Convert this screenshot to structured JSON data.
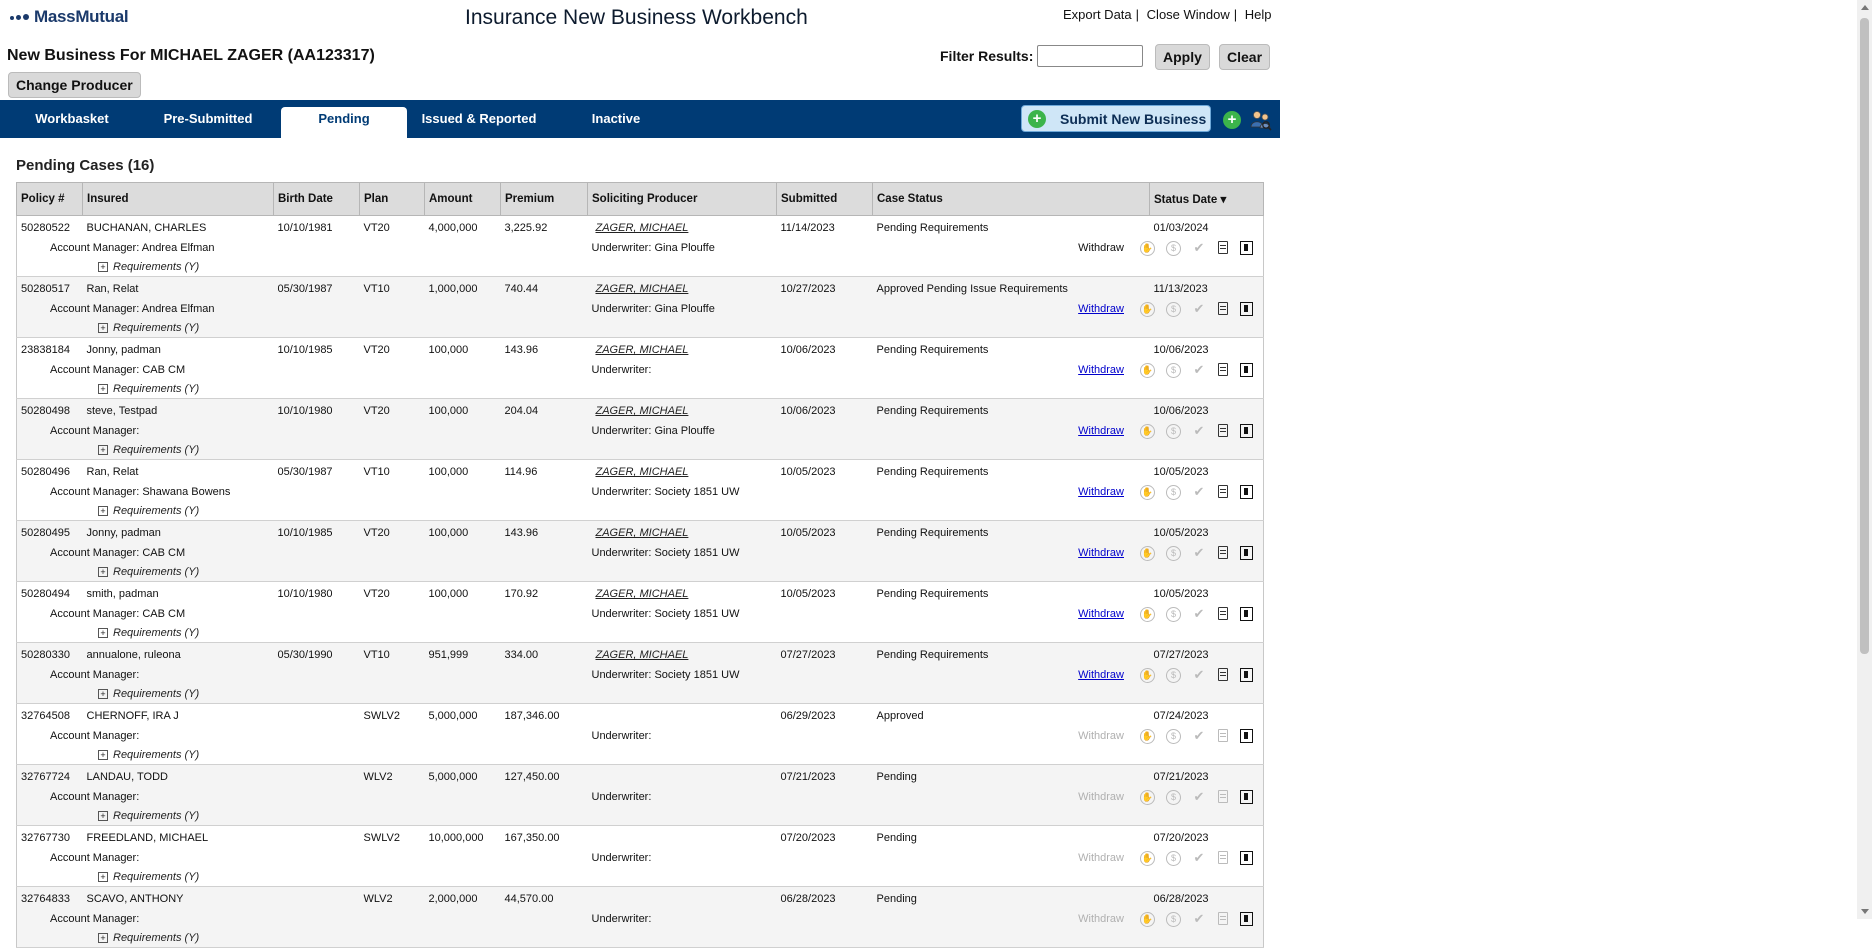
{
  "brand": {
    "logo_text": "MassMutual"
  },
  "app_title": "Insurance New Business Workbench",
  "top_links": {
    "export": "Export Data",
    "close": "Close Window",
    "help": "Help"
  },
  "page_heading": "New Business For MICHAEL ZAGER (AA123317)",
  "filter": {
    "label": "Filter Results:",
    "value": "",
    "apply": "Apply",
    "clear": "Clear"
  },
  "change_producer": "Change Producer",
  "tabs": [
    {
      "label": "Workbasket"
    },
    {
      "label": "Pre-Submitted"
    },
    {
      "label": "Pending",
      "active": true
    },
    {
      "label": "Issued & Reported"
    },
    {
      "label": "Inactive"
    }
  ],
  "submit_new_business": "Submit New Business",
  "section_title": "Pending Cases (16)",
  "columns": [
    "Policy #",
    "Insured",
    "Birth Date",
    "Plan",
    "Amount",
    "Premium",
    "Soliciting Producer",
    "Submitted",
    "Case Status",
    "Status Date"
  ],
  "sort_indicator": "▾",
  "labels": {
    "account_manager": "Account Manager:",
    "underwriter": "Underwriter:",
    "withdraw": "Withdraw",
    "requirements": "Requirements (Y)"
  },
  "cases": [
    {
      "policy": "50280522",
      "insured": "BUCHANAN, CHARLES",
      "birth": "10/10/1981",
      "plan": "VT20",
      "amount": "4,000,000",
      "premium": "3,225.92",
      "producer": "ZAGER, MICHAEL",
      "submitted": "11/14/2023",
      "status": "Pending Requirements",
      "status_date": "01/03/2024",
      "acct_mgr": "Andrea Elfman",
      "underwriter": "Gina Plouffe",
      "withdraw": "plain"
    },
    {
      "policy": "50280517",
      "insured": "Ran, Relat",
      "birth": "05/30/1987",
      "plan": "VT10",
      "amount": "1,000,000",
      "premium": "740.44",
      "producer": "ZAGER, MICHAEL",
      "submitted": "10/27/2023",
      "status": "Approved Pending Issue Requirements",
      "status_date": "11/13/2023",
      "acct_mgr": "Andrea Elfman",
      "underwriter": "Gina Plouffe",
      "withdraw": "link"
    },
    {
      "policy": "23838184",
      "insured": "Jonny, padman",
      "birth": "10/10/1985",
      "plan": "VT20",
      "amount": "100,000",
      "premium": "143.96",
      "producer": "ZAGER, MICHAEL",
      "submitted": "10/06/2023",
      "status": "Pending Requirements",
      "status_date": "10/06/2023",
      "acct_mgr": "CAB CM",
      "underwriter": "",
      "withdraw": "link"
    },
    {
      "policy": "50280498",
      "insured": "steve, Testpad",
      "birth": "10/10/1980",
      "plan": "VT20",
      "amount": "100,000",
      "premium": "204.04",
      "producer": "ZAGER, MICHAEL",
      "submitted": "10/06/2023",
      "status": "Pending Requirements",
      "status_date": "10/06/2023",
      "acct_mgr": "",
      "underwriter": "Gina Plouffe",
      "withdraw": "link"
    },
    {
      "policy": "50280496",
      "insured": "Ran, Relat",
      "birth": "05/30/1987",
      "plan": "VT10",
      "amount": "100,000",
      "premium": "114.96",
      "producer": "ZAGER, MICHAEL",
      "submitted": "10/05/2023",
      "status": "Pending Requirements",
      "status_date": "10/05/2023",
      "acct_mgr": "Shawana Bowens",
      "underwriter": "Society 1851 UW",
      "withdraw": "link"
    },
    {
      "policy": "50280495",
      "insured": "Jonny, padman",
      "birth": "10/10/1985",
      "plan": "VT20",
      "amount": "100,000",
      "premium": "143.96",
      "producer": "ZAGER, MICHAEL",
      "submitted": "10/05/2023",
      "status": "Pending Requirements",
      "status_date": "10/05/2023",
      "acct_mgr": "CAB CM",
      "underwriter": "Society 1851 UW",
      "withdraw": "link"
    },
    {
      "policy": "50280494",
      "insured": "smith, padman",
      "birth": "10/10/1980",
      "plan": "VT20",
      "amount": "100,000",
      "premium": "170.92",
      "producer": "ZAGER, MICHAEL",
      "submitted": "10/05/2023",
      "status": "Pending Requirements",
      "status_date": "10/05/2023",
      "acct_mgr": "CAB CM",
      "underwriter": "Society 1851 UW",
      "withdraw": "link"
    },
    {
      "policy": "50280330",
      "insured": "annualone, ruleona",
      "birth": "05/30/1990",
      "plan": "VT10",
      "amount": "951,999",
      "premium": "334.00",
      "producer": "ZAGER, MICHAEL",
      "submitted": "07/27/2023",
      "status": "Pending Requirements",
      "status_date": "07/27/2023",
      "acct_mgr": "",
      "underwriter": "Society 1851 UW",
      "withdraw": "link"
    },
    {
      "policy": "32764508",
      "insured": "CHERNOFF, IRA J",
      "birth": "",
      "plan": "SWLV2",
      "amount": "5,000,000",
      "premium": "187,346.00",
      "producer": "",
      "submitted": "06/29/2023",
      "status": "Approved",
      "status_date": "07/24/2023",
      "acct_mgr": "",
      "underwriter": "",
      "withdraw": "disabled"
    },
    {
      "policy": "32767724",
      "insured": "LANDAU, TODD",
      "birth": "",
      "plan": "WLV2",
      "amount": "5,000,000",
      "premium": "127,450.00",
      "producer": "",
      "submitted": "07/21/2023",
      "status": "Pending",
      "status_date": "07/21/2023",
      "acct_mgr": "",
      "underwriter": "",
      "withdraw": "disabled"
    },
    {
      "policy": "32767730",
      "insured": "FREEDLAND, MICHAEL",
      "birth": "",
      "plan": "SWLV2",
      "amount": "10,000,000",
      "premium": "167,350.00",
      "producer": "",
      "submitted": "07/20/2023",
      "status": "Pending",
      "status_date": "07/20/2023",
      "acct_mgr": "",
      "underwriter": "",
      "withdraw": "disabled"
    },
    {
      "policy": "32764833",
      "insured": "SCAVO, ANTHONY",
      "birth": "",
      "plan": "WLV2",
      "amount": "2,000,000",
      "premium": "44,570.00",
      "producer": "",
      "submitted": "06/28/2023",
      "status": "Pending",
      "status_date": "06/28/2023",
      "acct_mgr": "",
      "underwriter": "",
      "withdraw": "disabled"
    }
  ]
}
